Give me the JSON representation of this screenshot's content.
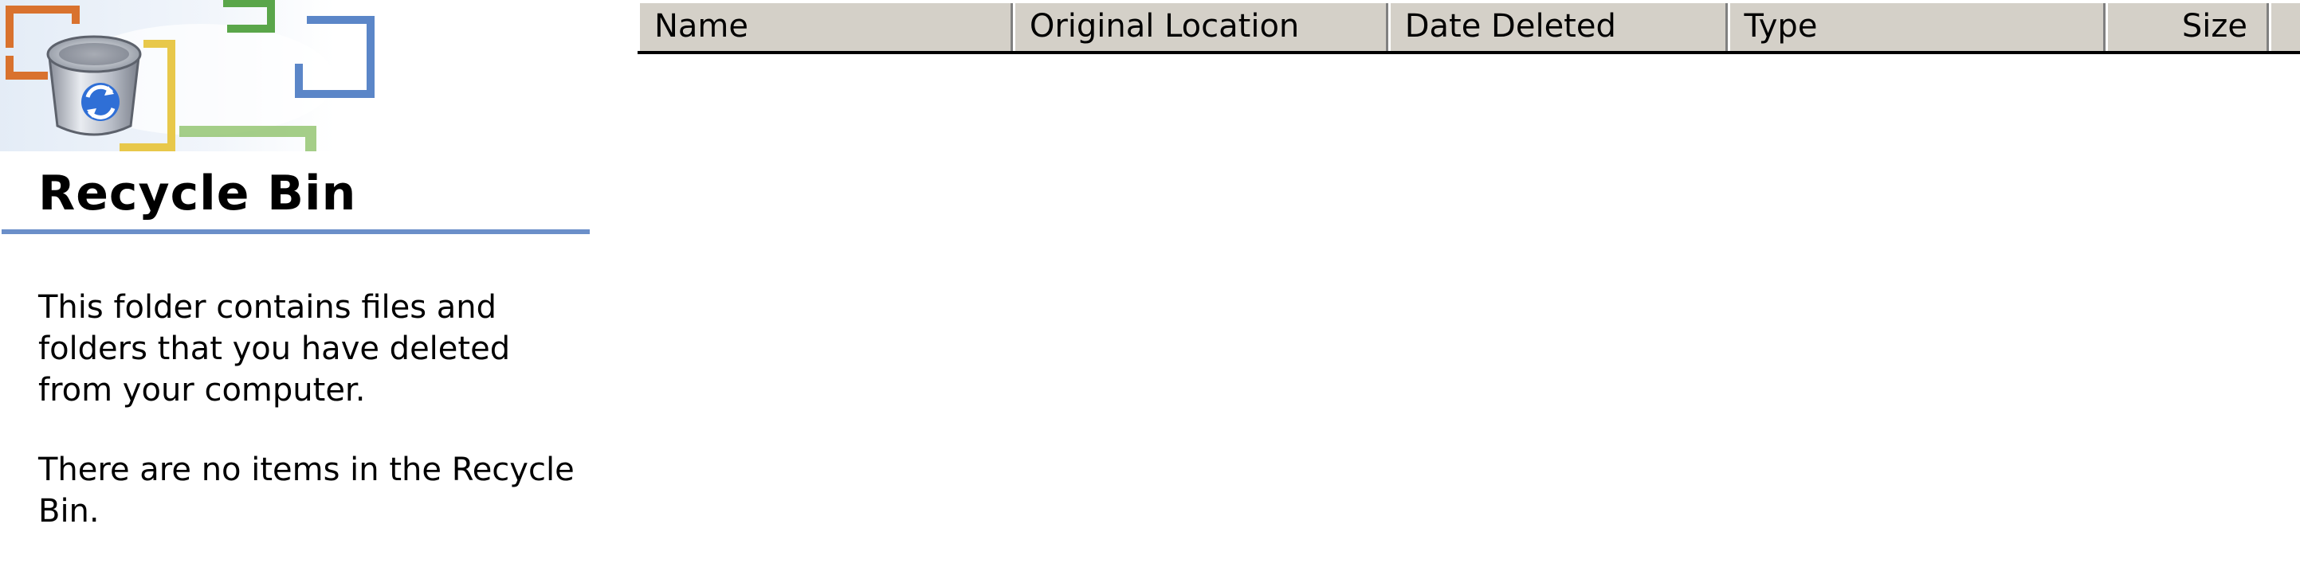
{
  "task_pane": {
    "title": "Recycle Bin",
    "description": "This folder contains files and folders that you have deleted from your computer.",
    "empty_message": "There are no items in the Recycle Bin.",
    "accent_color": "#6b8fc9",
    "icon": "recycle-bin-icon"
  },
  "file_list": {
    "columns": [
      {
        "label": "Name"
      },
      {
        "label": "Original Location"
      },
      {
        "label": "Date Deleted"
      },
      {
        "label": "Type"
      },
      {
        "label": "Size"
      }
    ],
    "rows": []
  }
}
